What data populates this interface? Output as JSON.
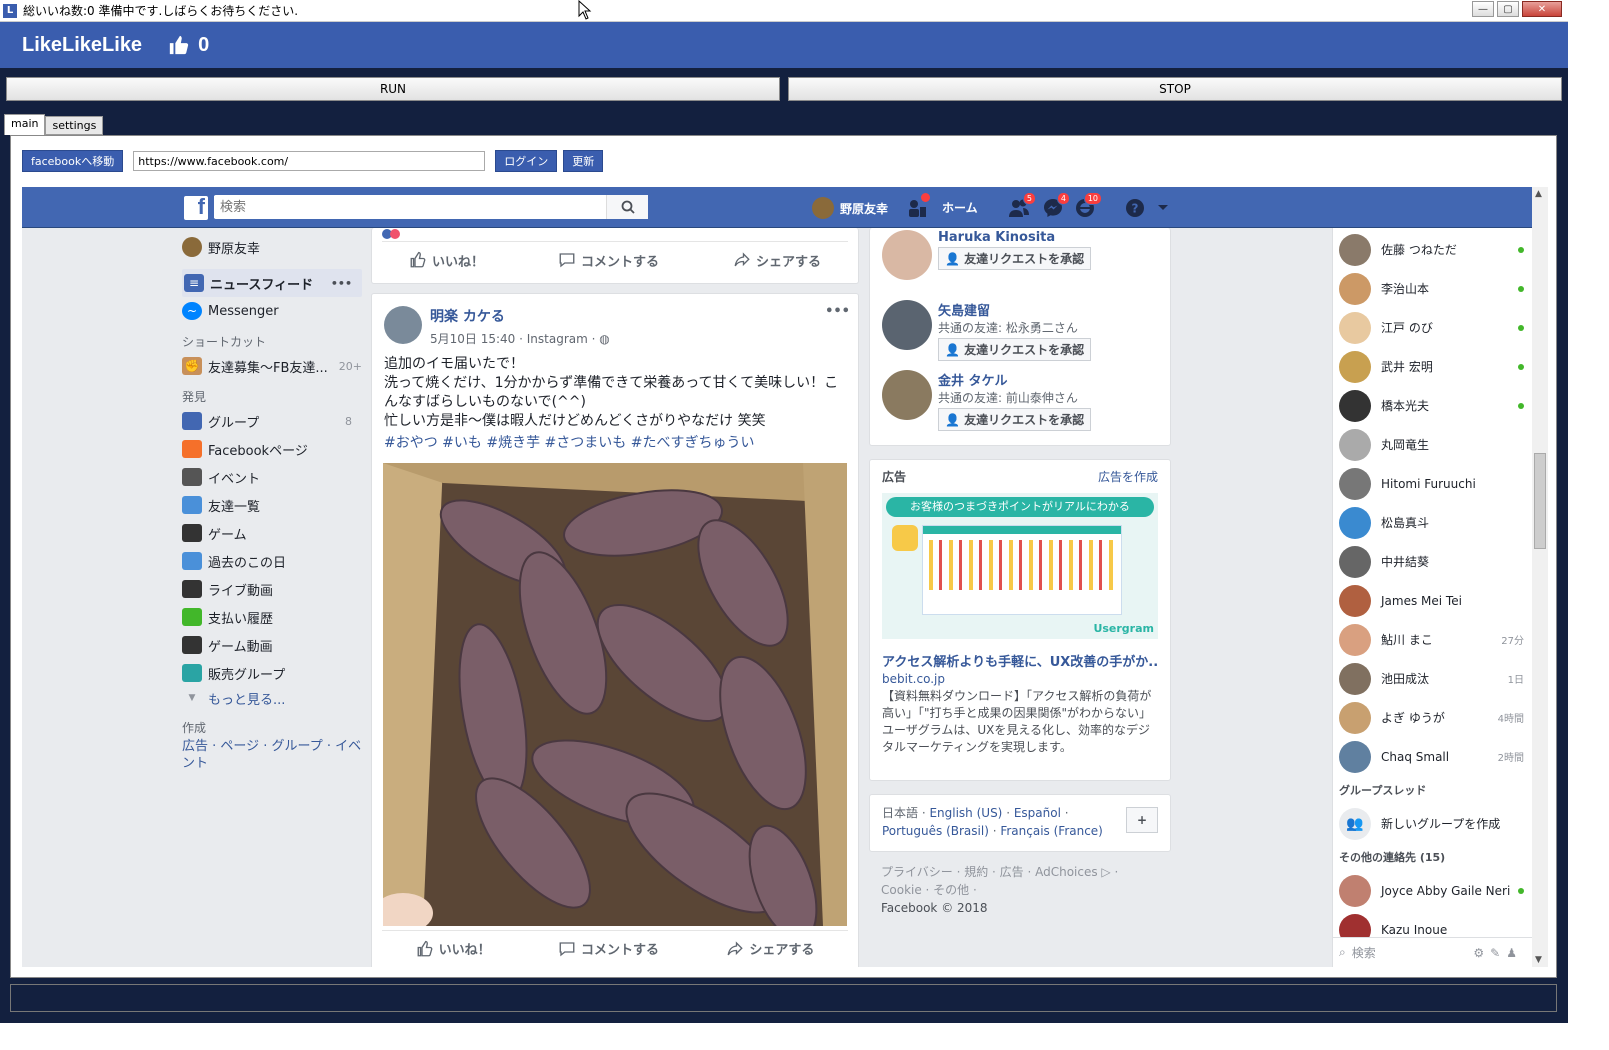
{
  "window": {
    "title": "総いいね数:0 準備中です.しばらくお待ちください.",
    "min": "—",
    "max": "▢",
    "close": "✕"
  },
  "app": {
    "name": "LikeLikeLike",
    "like_count": "0",
    "run": "RUN",
    "stop": "STOP"
  },
  "tabs": [
    "main",
    "settings"
  ],
  "toolbar": {
    "goto_facebook": "facebookへ移動",
    "url": "https://www.facebook.com/",
    "login": "ログイン",
    "refresh": "更新"
  },
  "fb": {
    "search_placeholder": "検索",
    "user": "野原友幸",
    "home": "ホーム",
    "badges": {
      "friends": "5",
      "messages": "4",
      "notifications": "10"
    },
    "left": {
      "user": "野原友幸",
      "newsfeed": "ニュースフィード",
      "messenger": "Messenger",
      "shortcut_head": "ショートカット",
      "shortcut": {
        "label": "友達募集～FB友達...",
        "count": "20+"
      },
      "discover_head": "発見",
      "discover": [
        {
          "label": "グループ",
          "count": "8",
          "icon": "groups-icon",
          "color": "#4267b2"
        },
        {
          "label": "Facebookページ",
          "count": "",
          "icon": "pages-icon",
          "color": "#f5702a"
        },
        {
          "label": "イベント",
          "count": "",
          "icon": "calendar-icon",
          "color": "#555"
        },
        {
          "label": "友達一覧",
          "count": "",
          "icon": "friends-list-icon",
          "color": "#4a90d9"
        },
        {
          "label": "ゲーム",
          "count": "",
          "icon": "games-icon",
          "color": "#333"
        },
        {
          "label": "過去のこの日",
          "count": "",
          "icon": "memories-icon",
          "color": "#4a90d9"
        },
        {
          "label": "ライブ動画",
          "count": "",
          "icon": "live-video-icon",
          "color": "#333"
        },
        {
          "label": "支払い履歴",
          "count": "",
          "icon": "payments-icon",
          "color": "#42b72a"
        },
        {
          "label": "ゲーム動画",
          "count": "",
          "icon": "gamepad-icon",
          "color": "#333"
        },
        {
          "label": "販売グループ",
          "count": "",
          "icon": "tag-icon",
          "color": "#2aa4a4"
        }
      ],
      "more": "もっと見る...",
      "create_head": "作成",
      "create_links": "広告 · ページ · グループ · イベント"
    },
    "post": {
      "author": "明楽 カケる",
      "meta": "5月10日 15:40 · Instagram · ",
      "lines": [
        "追加のイモ届いたで！",
        "洗って焼くだけ、1分かからず準備できて栄養あって甘くて美味しい！こんなすばらしいものないで(^^)",
        "忙しい方是非〜僕は暇人だけどめんどくさがりやなだけ 笑笑"
      ],
      "hashtags": "#おやつ #いも #焼き芋 #さつまいも #たべすぎちゅうい",
      "like": "いいね！",
      "comment": "コメントする",
      "share": "シェアする"
    },
    "requests": [
      {
        "name": "Haruka Kinosita",
        "mutual": "",
        "button": "友達リクエストを承認",
        "color": "#d9b8a4"
      },
      {
        "name": "矢島建留",
        "mutual": "共通の友達: 松永勇二さん",
        "button": "友達リクエストを承認",
        "color": "#5a6470"
      },
      {
        "name": "金井 タケル",
        "mutual": "共通の友達: 前山泰伸さん",
        "button": "友達リクエストを承認",
        "color": "#8a7a60"
      }
    ],
    "ad": {
      "head": "広告",
      "create": "広告を作成",
      "banner": "お客様のつまづきポイントがリアルにわかる",
      "brand": "Usergram",
      "title": "アクセス解析よりも手軽に、UX改善の手がか...",
      "domain": "bebit.co.jp",
      "body": "【資料無料ダウンロード】「アクセス解析の負荷が高い」「\"打ち手と成果の因果関係\"がわからない」ユーザグラムは、UXを見える化し、効率的なデジタルマーケティングを実現します。"
    },
    "langs": {
      "current": "日本語 · ",
      "l1": "English (US)",
      "sep1": " · ",
      "l2": "Español",
      "sep2": " · ",
      "l3": "Português (Brasil)",
      "sep3": " · ",
      "l4": "Français (France)",
      "plus": "+"
    },
    "footer": {
      "line1": "プライバシー · 規約 · 広告 · AdChoices ▷ ·",
      "line2": "Cookie · その他 ·",
      "copy": "Facebook © 2018"
    },
    "chat": {
      "contacts": [
        {
          "name": "佐藤 つねただ",
          "status": "online",
          "time": "",
          "color": "#8a7a6a"
        },
        {
          "name": "李治山本",
          "status": "online",
          "time": "",
          "color": "#c96"
        },
        {
          "name": "江戸 のび",
          "status": "online",
          "time": "",
          "color": "#e8c9a0"
        },
        {
          "name": "武井 宏明",
          "status": "online",
          "time": "",
          "color": "#c8a050"
        },
        {
          "name": "橋本光夫",
          "status": "online",
          "time": "",
          "color": "#333"
        },
        {
          "name": "丸岡竜生",
          "status": "",
          "time": "",
          "color": "#aaa"
        },
        {
          "name": "Hitomi Furuuchi",
          "status": "",
          "time": "",
          "color": "#777"
        },
        {
          "name": "松島真斗",
          "status": "",
          "time": "",
          "color": "#3a8ad0"
        },
        {
          "name": "中井結葵",
          "status": "",
          "time": "",
          "color": "#666"
        },
        {
          "name": "James Mei Tei",
          "status": "",
          "time": "",
          "color": "#b06040"
        },
        {
          "name": "鮎川 まこ",
          "status": "",
          "time": "27分",
          "color": "#d9a080"
        },
        {
          "name": "池田成汰",
          "status": "",
          "time": "1日",
          "color": "#807060"
        },
        {
          "name": "よぎ ゆうが",
          "status": "",
          "time": "4時間",
          "color": "#c8a070"
        },
        {
          "name": "Chaq Small",
          "status": "",
          "time": "2時間",
          "color": "#6080a0"
        }
      ],
      "group_head": "グループスレッド",
      "new_group": "新しいグループを作成",
      "other_head": "その他の連絡先 (15)",
      "other": [
        {
          "name": "Joyce Abby Gaile Neri",
          "status": "online",
          "color": "#c08070"
        },
        {
          "name": "Kazu Inoue",
          "status": "",
          "color": "#a03030"
        }
      ],
      "search": "検索"
    }
  }
}
